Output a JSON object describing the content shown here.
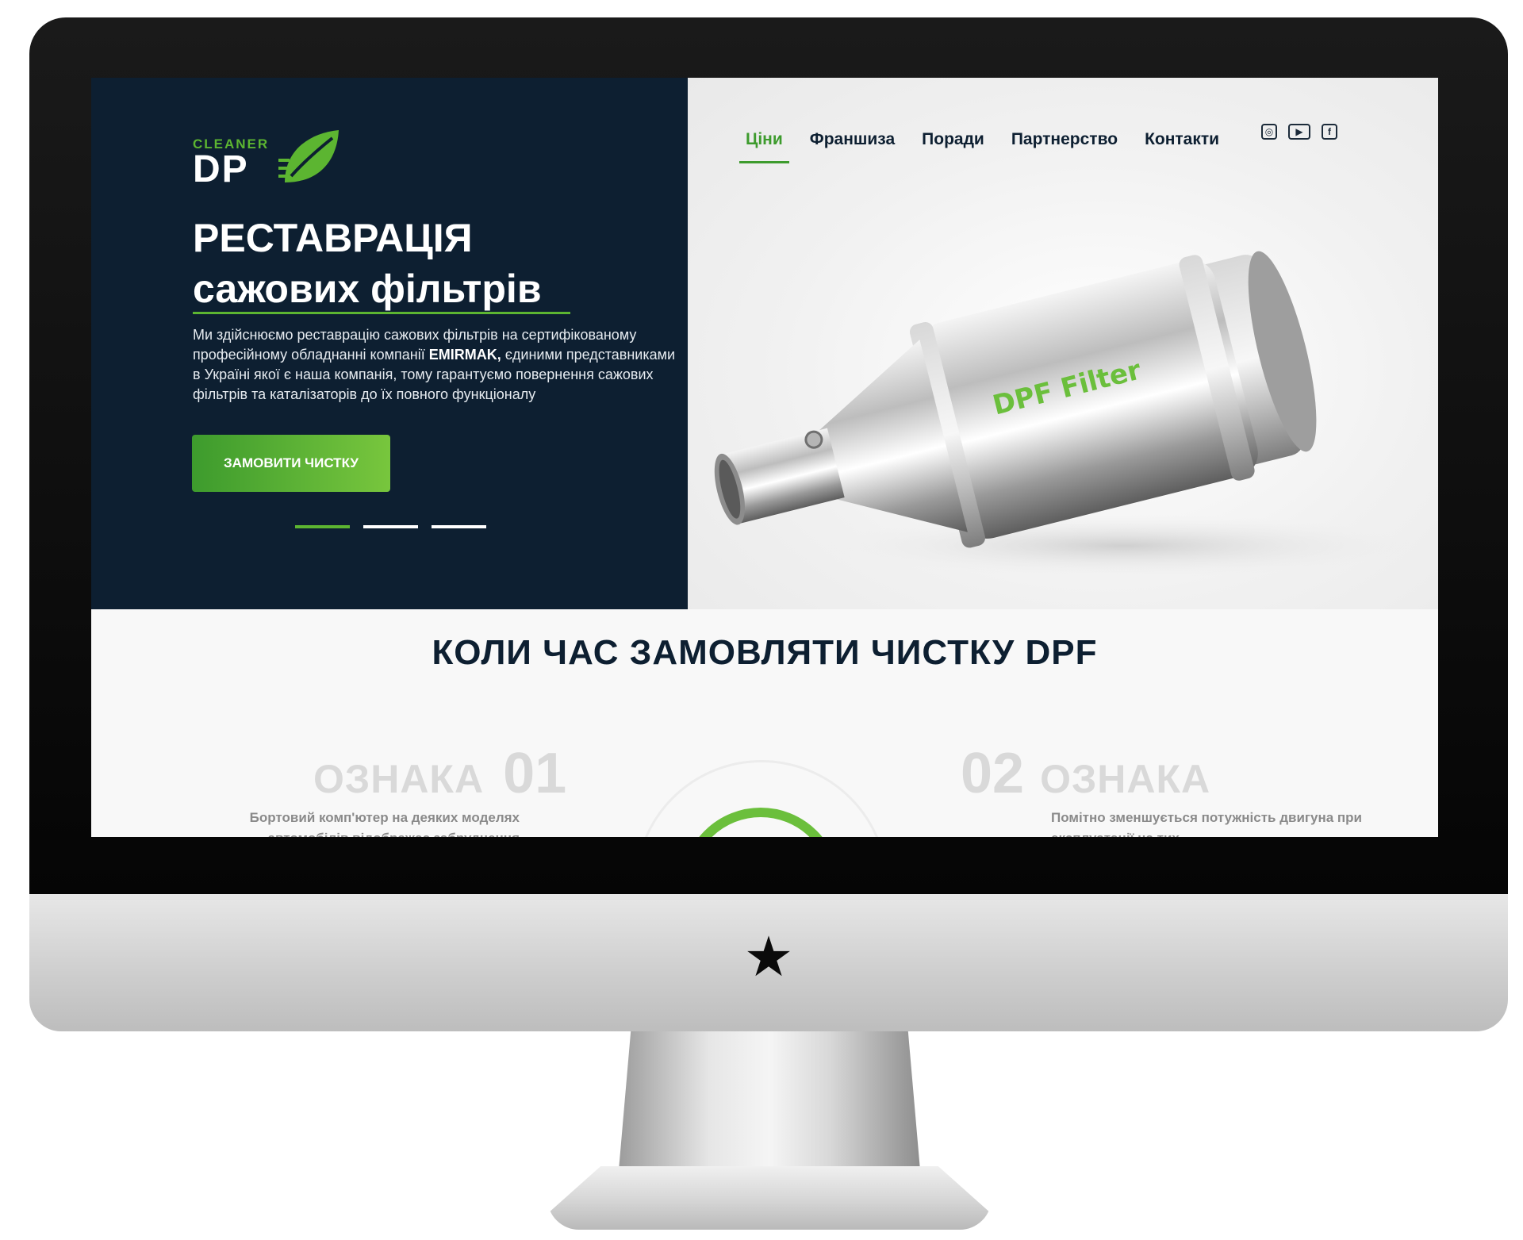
{
  "brand": {
    "logo_small": "CLEANER",
    "logo_big": "DP",
    "logo_leaf_icon": "leaf-icon",
    "accent_color": "#5cb531",
    "dark_color": "#0d1f31"
  },
  "nav": {
    "items": [
      {
        "label": "Ціни",
        "active": true
      },
      {
        "label": "Франшиза",
        "active": false
      },
      {
        "label": "Поради",
        "active": false
      },
      {
        "label": "Партнерство",
        "active": false
      },
      {
        "label": "Контакти",
        "active": false
      }
    ],
    "social_icons": [
      "instagram-icon",
      "youtube-icon",
      "facebook-icon"
    ]
  },
  "hero": {
    "title_line1": "РЕСТАВРАЦІЯ",
    "title_line2": "сажових фільтрів",
    "desc_part1": "Ми здійснюємо реставрацію сажових фільтрів на сертифікованому професійному обладнанні компанії ",
    "desc_bold": "EMIRMAK,",
    "desc_part2": " єдиними представниками в Україні якої є наша компанія, тому гарантуємо повернення сажових фільтрів та каталізаторів до їх повного функціоналу",
    "cta_label": "ЗАМОВИТИ ЧИСТКУ",
    "slider_total": 3,
    "slider_active": 1,
    "product_label": "DPF Filter"
  },
  "signs": {
    "title": "КОЛИ ЧАС ЗАМОВЛЯТИ ЧИСТКУ DPF",
    "left": {
      "word": "ОЗНАКА",
      "num": "01",
      "text": "Бортовий комп'ютер на деяких моделях автомобілів відображає забруднення"
    },
    "right": {
      "word": "ОЗНАКА",
      "num": "02",
      "text": "Помітно зменшується потужність двигуна при експлуатації на тих"
    }
  },
  "device": {
    "logo_icon": "star-icon"
  }
}
